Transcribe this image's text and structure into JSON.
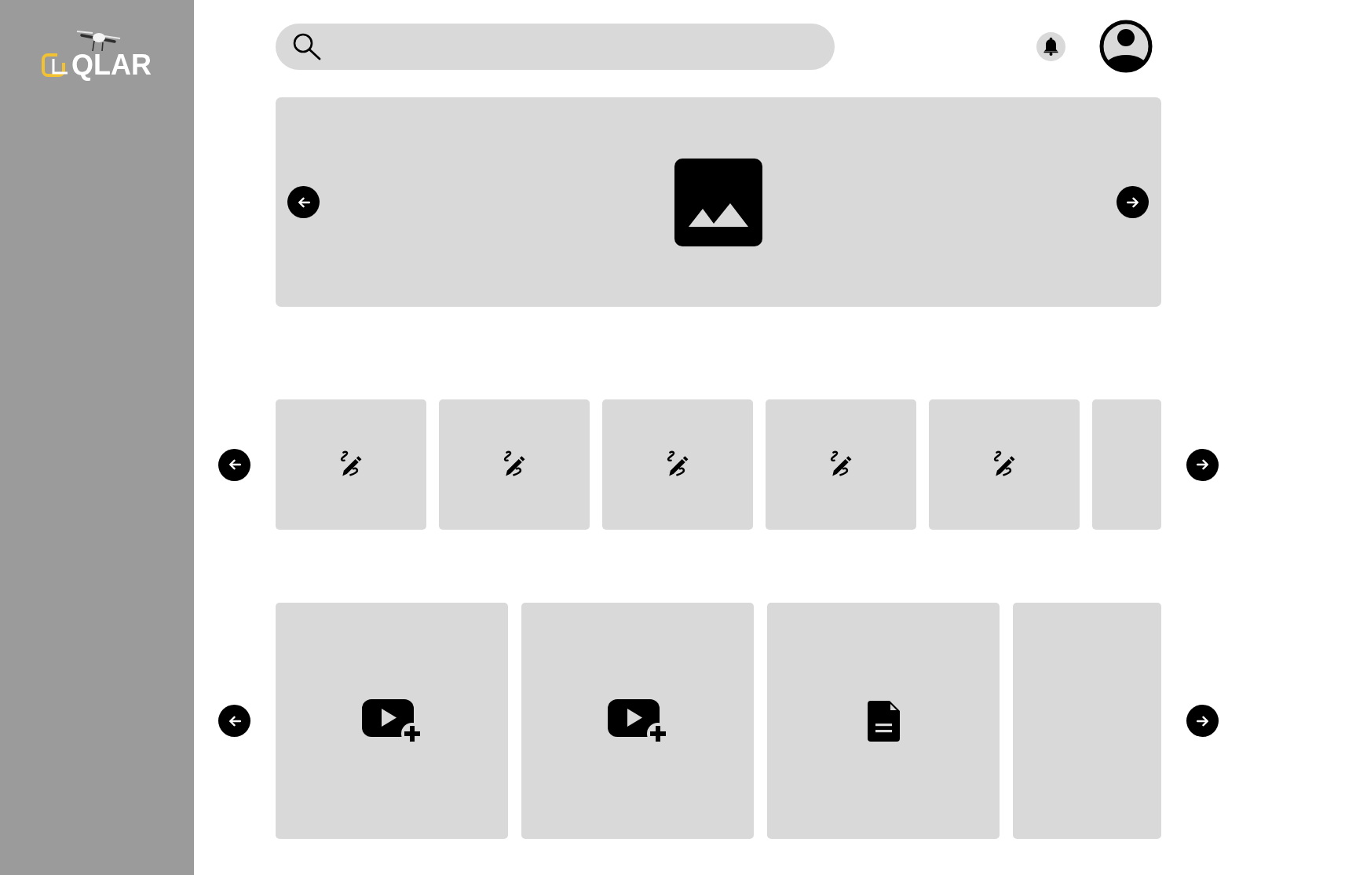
{
  "logo": {
    "text": "QLAR"
  },
  "hero_banner": {
    "kind": "image"
  },
  "carousels": [
    {
      "cards": [
        {
          "kind": "sketch"
        },
        {
          "kind": "sketch"
        },
        {
          "kind": "sketch"
        },
        {
          "kind": "sketch"
        },
        {
          "kind": "sketch"
        },
        {
          "kind": "blank"
        }
      ]
    },
    {
      "cards": [
        {
          "kind": "video"
        },
        {
          "kind": "video"
        },
        {
          "kind": "document"
        },
        {
          "kind": "blank"
        }
      ]
    }
  ]
}
